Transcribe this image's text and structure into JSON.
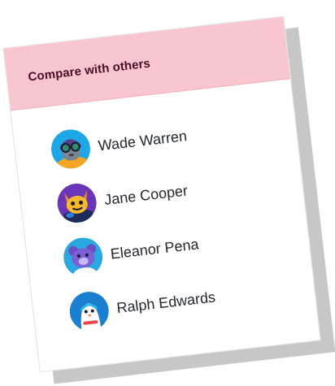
{
  "card": {
    "title": "Compare with others",
    "header_color": "#f9c6cf",
    "title_color": "#4a0d2a"
  },
  "users": [
    {
      "name": "Wade Warren",
      "avatar": "pilot-goggles-avatar-icon"
    },
    {
      "name": "Jane Cooper",
      "avatar": "horned-creature-avatar-icon"
    },
    {
      "name": "Eleanor Pena",
      "avatar": "bear-avatar-icon"
    },
    {
      "name": "Ralph Edwards",
      "avatar": "penguin-avatar-icon"
    }
  ]
}
